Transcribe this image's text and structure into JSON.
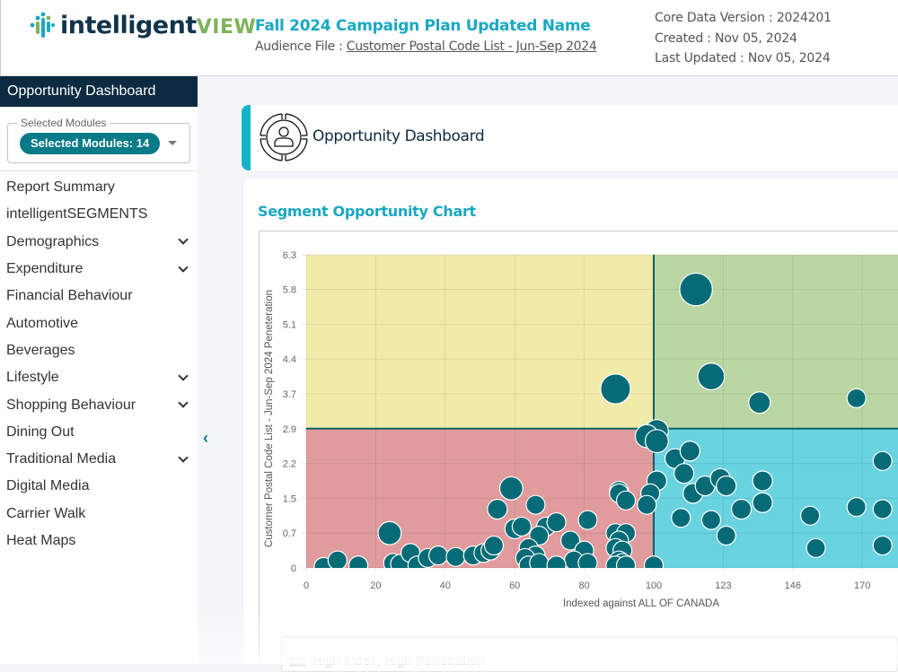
{
  "header": {
    "logo_main": "intelligent",
    "logo_accent": "VIEW",
    "plan_title": "Fall 2024 Campaign Plan Updated Name",
    "audience_label": "Audience File : ",
    "audience_link": "Customer Postal Code List - Jun-Sep 2024",
    "core_data_version": "Core Data Version : 2024201",
    "created": "Created : Nov 05, 2024",
    "last_updated": "Last Updated : Nov 05, 2024"
  },
  "sidebar": {
    "heading": "Opportunity Dashboard",
    "modules_legend": "Selected Modules",
    "modules_chip": "Selected Modules: 14",
    "items": [
      {
        "label": "Report Summary",
        "expandable": false
      },
      {
        "label": "intelligentSEGMENTS",
        "expandable": false
      },
      {
        "label": "Demographics",
        "expandable": true
      },
      {
        "label": "Expenditure",
        "expandable": true
      },
      {
        "label": "Financial Behaviour",
        "expandable": false
      },
      {
        "label": "Automotive",
        "expandable": false
      },
      {
        "label": "Beverages",
        "expandable": false
      },
      {
        "label": "Lifestyle",
        "expandable": true
      },
      {
        "label": "Shopping Behaviour",
        "expandable": true
      },
      {
        "label": "Dining Out",
        "expandable": false
      },
      {
        "label": "Traditional Media",
        "expandable": true
      },
      {
        "label": "Digital Media",
        "expandable": false
      },
      {
        "label": "Carrier Walk",
        "expandable": false
      },
      {
        "label": "Heat Maps",
        "expandable": false
      }
    ],
    "collapse_icon": "chevron-left-icon"
  },
  "main": {
    "page_title": "Opportunity Dashboard",
    "page_icon": "target-person-icon",
    "chart_section_title": "Segment Opportunity Chart",
    "next_section_title": "High Index, High Penetration"
  },
  "colors": {
    "accent": "#19a8c2",
    "nav_dark": "#0c2a40",
    "chip": "#077b87",
    "bubble": "#066b76",
    "quad_low_index_high_pen": "#f0eba8",
    "quad_high_index_high_pen": "#bad6a3",
    "quad_low_index_low_pen": "#e09b9d",
    "quad_high_index_low_pen": "#69d3e0"
  },
  "chart_data": {
    "type": "scatter",
    "subtype": "bubble",
    "title": "Segment Opportunity Chart",
    "xlabel": "Indexed against ALL OF CANADA",
    "ylabel": "Customer Postal Code List - Jun-Sep 2024 Peneteration",
    "x_ticks": [
      0,
      20,
      40,
      60,
      80,
      100,
      123,
      146,
      170
    ],
    "y_ticks": [
      0,
      0.7,
      1.5,
      2.2,
      2.9,
      3.7,
      4.4,
      5.1,
      5.8,
      6.3
    ],
    "xlim": [
      0,
      180
    ],
    "ylim": [
      0,
      6.3
    ],
    "grid": true,
    "quadrant_split": {
      "x": 100,
      "y": 2.9
    },
    "points": [
      {
        "x": 114,
        "y": 5.8,
        "size": 3
      },
      {
        "x": 119,
        "y": 4.05,
        "size": 2
      },
      {
        "x": 89,
        "y": 3.8,
        "size": 2.5
      },
      {
        "x": 135,
        "y": 3.5,
        "size": 1.3
      },
      {
        "x": 168,
        "y": 3.6,
        "size": 1
      },
      {
        "x": 101,
        "y": 2.85,
        "size": 1.5
      },
      {
        "x": 98,
        "y": 2.75,
        "size": 1.5
      },
      {
        "x": 101,
        "y": 2.65,
        "size": 1.5
      },
      {
        "x": 107,
        "y": 2.3,
        "size": 1.1
      },
      {
        "x": 112,
        "y": 2.45,
        "size": 1.1
      },
      {
        "x": 110,
        "y": 2.0,
        "size": 1.1
      },
      {
        "x": 101,
        "y": 1.85,
        "size": 1.1
      },
      {
        "x": 113,
        "y": 1.6,
        "size": 1.1
      },
      {
        "x": 117,
        "y": 1.75,
        "size": 1.1
      },
      {
        "x": 122,
        "y": 1.9,
        "size": 1.1
      },
      {
        "x": 124,
        "y": 1.75,
        "size": 1.1
      },
      {
        "x": 136,
        "y": 1.85,
        "size": 1.1
      },
      {
        "x": 136,
        "y": 1.4,
        "size": 1.1
      },
      {
        "x": 129,
        "y": 1.25,
        "size": 1.1
      },
      {
        "x": 109,
        "y": 1.05,
        "size": 1
      },
      {
        "x": 119,
        "y": 1.0,
        "size": 1
      },
      {
        "x": 124,
        "y": 0.65,
        "size": 1
      },
      {
        "x": 152,
        "y": 1.1,
        "size": 1
      },
      {
        "x": 154,
        "y": 0.4,
        "size": 1
      },
      {
        "x": 168,
        "y": 1.3,
        "size": 1
      },
      {
        "x": 177,
        "y": 2.25,
        "size": 1
      },
      {
        "x": 177,
        "y": 1.25,
        "size": 1
      },
      {
        "x": 177,
        "y": 0.45,
        "size": 1
      },
      {
        "x": 99,
        "y": 1.6,
        "size": 1
      },
      {
        "x": 98,
        "y": 1.35,
        "size": 1
      },
      {
        "x": 100,
        "y": 0.05,
        "size": 1
      },
      {
        "x": 90,
        "y": 1.65,
        "size": 1
      },
      {
        "x": 90,
        "y": 1.6,
        "size": 1
      },
      {
        "x": 92,
        "y": 1.45,
        "size": 1
      },
      {
        "x": 89,
        "y": 0.7,
        "size": 1
      },
      {
        "x": 92,
        "y": 0.7,
        "size": 1
      },
      {
        "x": 90,
        "y": 0.55,
        "size": 1
      },
      {
        "x": 89,
        "y": 0.4,
        "size": 1
      },
      {
        "x": 91,
        "y": 0.35,
        "size": 1
      },
      {
        "x": 90,
        "y": 0.15,
        "size": 1
      },
      {
        "x": 91,
        "y": 0.1,
        "size": 1
      },
      {
        "x": 89,
        "y": 0.05,
        "size": 1
      },
      {
        "x": 92,
        "y": 0.05,
        "size": 1
      },
      {
        "x": 81,
        "y": 1.0,
        "size": 1
      },
      {
        "x": 76,
        "y": 0.55,
        "size": 1
      },
      {
        "x": 80,
        "y": 0.35,
        "size": 1
      },
      {
        "x": 77,
        "y": 0.15,
        "size": 1
      },
      {
        "x": 81,
        "y": 0.1,
        "size": 1
      },
      {
        "x": 59,
        "y": 1.7,
        "size": 1.5
      },
      {
        "x": 55,
        "y": 1.25,
        "size": 1.1
      },
      {
        "x": 66,
        "y": 1.35,
        "size": 1
      },
      {
        "x": 60,
        "y": 0.8,
        "size": 1.1
      },
      {
        "x": 62,
        "y": 0.85,
        "size": 1
      },
      {
        "x": 69,
        "y": 0.85,
        "size": 1
      },
      {
        "x": 72,
        "y": 0.95,
        "size": 1
      },
      {
        "x": 67,
        "y": 0.65,
        "size": 1
      },
      {
        "x": 64,
        "y": 0.4,
        "size": 1
      },
      {
        "x": 66,
        "y": 0.25,
        "size": 1
      },
      {
        "x": 63,
        "y": 0.2,
        "size": 1
      },
      {
        "x": 64,
        "y": 0.05,
        "size": 1
      },
      {
        "x": 67,
        "y": 0.1,
        "size": 1
      },
      {
        "x": 72,
        "y": 0.05,
        "size": 1
      },
      {
        "x": 24,
        "y": 0.7,
        "size": 1.5
      },
      {
        "x": 25,
        "y": 0.1,
        "size": 1
      },
      {
        "x": 27,
        "y": 0.08,
        "size": 1
      },
      {
        "x": 30,
        "y": 0.3,
        "size": 1
      },
      {
        "x": 32,
        "y": 0.05,
        "size": 1
      },
      {
        "x": 35,
        "y": 0.2,
        "size": 1
      },
      {
        "x": 38,
        "y": 0.25,
        "size": 1
      },
      {
        "x": 43,
        "y": 0.22,
        "size": 1
      },
      {
        "x": 48,
        "y": 0.25,
        "size": 1
      },
      {
        "x": 51,
        "y": 0.3,
        "size": 1
      },
      {
        "x": 53,
        "y": 0.35,
        "size": 1
      },
      {
        "x": 54,
        "y": 0.45,
        "size": 1
      },
      {
        "x": 5,
        "y": 0.02,
        "size": 1
      },
      {
        "x": 9,
        "y": 0.15,
        "size": 1
      },
      {
        "x": 15,
        "y": 0.05,
        "size": 1
      }
    ]
  }
}
